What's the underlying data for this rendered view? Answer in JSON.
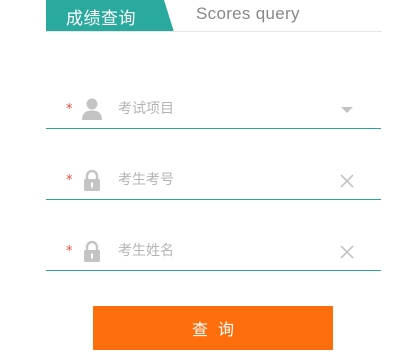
{
  "tabs": {
    "active_label": "成绩查询",
    "inactive_label": "Scores query"
  },
  "colors": {
    "tab_active_bg": "#2aaa9e",
    "field_underline": "#2aa39a",
    "required_mark": "#e94b3c",
    "icon_gray": "#c4c4c4",
    "submit_bg": "#ff6e0c"
  },
  "form": {
    "fields": [
      {
        "required_mark": "*",
        "icon": "user-icon",
        "placeholder": "考试项目",
        "value": "",
        "action_icon": "dropdown-arrow-icon"
      },
      {
        "required_mark": "*",
        "icon": "lock-icon",
        "placeholder": "考生考号",
        "value": "",
        "action_icon": "clear-icon"
      },
      {
        "required_mark": "*",
        "icon": "lock-icon",
        "placeholder": "考生姓名",
        "value": "",
        "action_icon": "clear-icon"
      }
    ],
    "submit_label": "查询"
  }
}
